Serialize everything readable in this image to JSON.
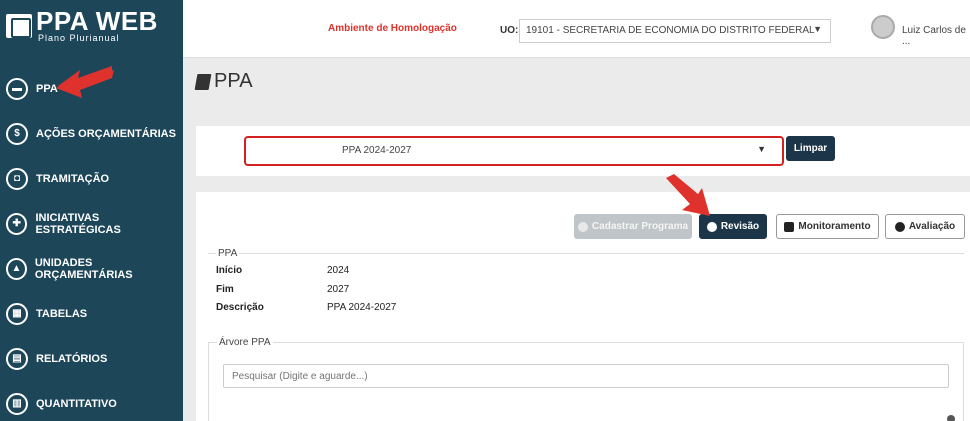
{
  "app": {
    "logo_title": "PPA WEB",
    "logo_subtitle": "Plano Plurianual"
  },
  "topbar": {
    "environment": "Ambiente de Homologação",
    "uo_label": "UO:",
    "uo_value": "19101 - SECRETARIA DE ECONOMIA DO DISTRITO FEDERAL",
    "user": "Luiz Carlos de ..."
  },
  "sidebar": {
    "items": [
      {
        "label": "PPA",
        "icon": "book-icon"
      },
      {
        "label": "AÇÕES ORÇAMENTÁRIAS",
        "icon": "dollar-icon"
      },
      {
        "label": "TRAMITAÇÃO",
        "icon": "inbox-icon"
      },
      {
        "label": "INICIATIVAS ESTRATÉGICAS",
        "icon": "puzzle-icon"
      },
      {
        "label": "UNIDADES ORÇAMENTÁRIAS",
        "icon": "bank-icon"
      },
      {
        "label": "TABELAS",
        "icon": "table-icon"
      },
      {
        "label": "RELATÓRIOS",
        "icon": "report-icon"
      },
      {
        "label": "QUANTITATIVO",
        "icon": "chart-icon"
      }
    ]
  },
  "page": {
    "title": "PPA"
  },
  "filter": {
    "selected": "PPA 2024-2027",
    "clear_label": "Limpar"
  },
  "actions": {
    "cadastrar": "Cadastrar Programa",
    "revisao": "Revisão",
    "monitoramento": "Monitoramento",
    "avaliacao": "Avaliação"
  },
  "ppa_details": {
    "legend": "PPA",
    "rows": [
      {
        "key": "Início",
        "value": "2024"
      },
      {
        "key": "Fim",
        "value": "2027"
      },
      {
        "key": "Descrição",
        "value": "PPA 2024-2027"
      }
    ]
  },
  "tree": {
    "legend": "Árvore PPA",
    "search_placeholder": "Pesquisar (Digite e aguarde...)"
  },
  "colors": {
    "sidebar": "#1d4659",
    "primary_button": "#1d3548",
    "annotation": "#e0322c"
  }
}
